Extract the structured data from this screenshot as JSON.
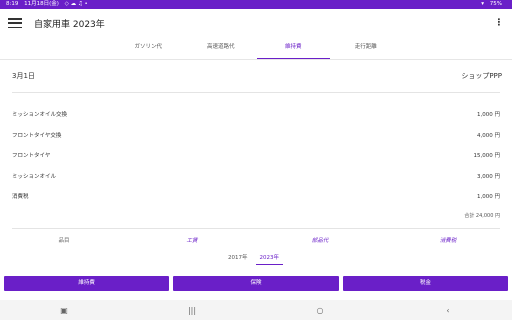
{
  "status": {
    "time": "8:19",
    "date": "11月18日(金)",
    "signal": "▾",
    "battery": "75%"
  },
  "appbar": {
    "title": "自家用車 2023年",
    "menu_icon": "hamburger-icon",
    "overflow_icon": "more-vert-icon"
  },
  "tabs": [
    {
      "label": "ガソリン代"
    },
    {
      "label": "高速道路代"
    },
    {
      "label": "維持費"
    },
    {
      "label": "走行距離"
    }
  ],
  "entry": {
    "date": "3月1日",
    "shop": "ショップPPP"
  },
  "items": [
    {
      "name": "ミッションオイル交換",
      "amount": "1,000 円"
    },
    {
      "name": "フロントタイヤ交換",
      "amount": "4,000 円"
    },
    {
      "name": "フロントタイヤ",
      "amount": "15,000 円"
    },
    {
      "name": "ミッションオイル",
      "amount": "3,000 円"
    },
    {
      "name": "消費税",
      "amount": "1,000 円"
    }
  ],
  "total": "合計 24,000 円",
  "categories": [
    {
      "label": "品目"
    },
    {
      "label": "工賃"
    },
    {
      "label": "部品代"
    },
    {
      "label": "消費税"
    }
  ],
  "years": [
    {
      "label": "2017年"
    },
    {
      "label": "2023年"
    }
  ],
  "buttons": [
    {
      "label": "維持費"
    },
    {
      "label": "保険"
    },
    {
      "label": "税金"
    }
  ],
  "colors": {
    "accent": "#6a1fc8"
  }
}
